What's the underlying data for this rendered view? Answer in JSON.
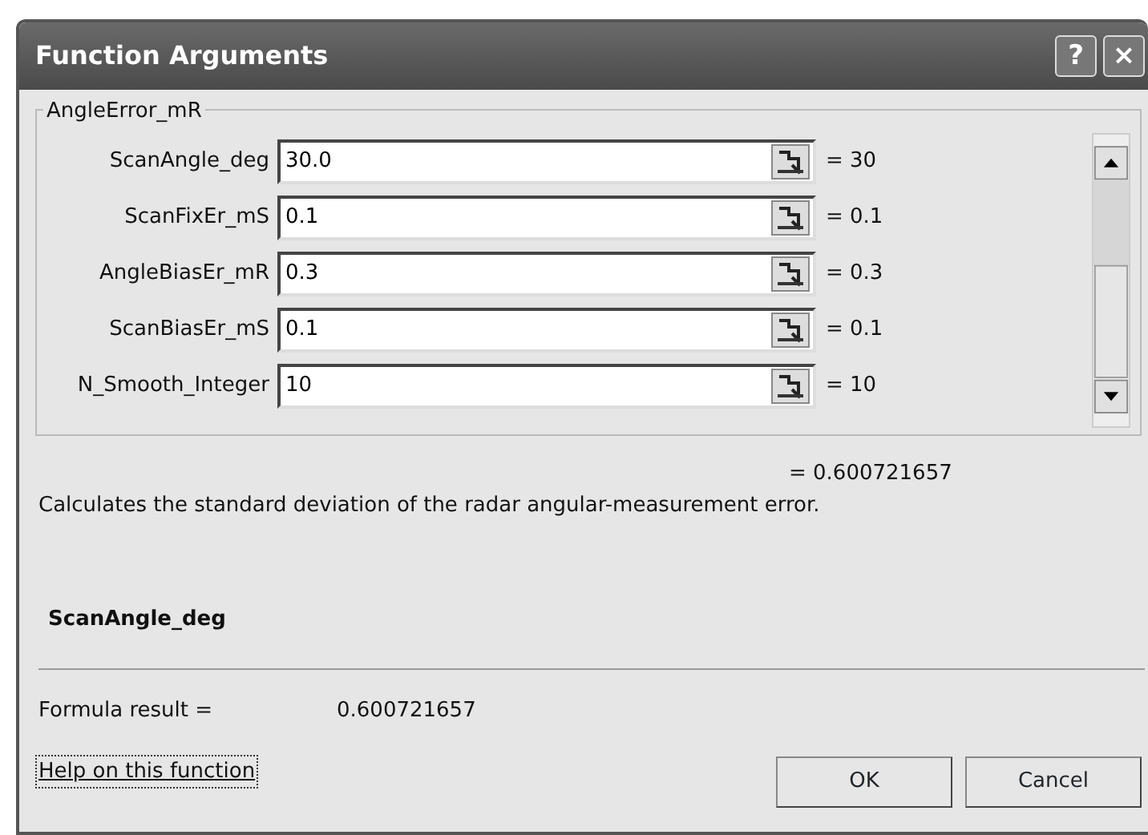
{
  "window": {
    "title": "Function Arguments",
    "controls": [
      "?",
      "×"
    ]
  },
  "group": {
    "legend": "AngleError_mR",
    "arguments": [
      {
        "label": "ScanAngle_deg",
        "value": "30.0",
        "result": "= 30"
      },
      {
        "label": "ScanFixEr_mS",
        "value": "0.1",
        "result": "= 0.1"
      },
      {
        "label": "AngleBiasEr_mR",
        "value": "0.3",
        "result": "= 0.3"
      },
      {
        "label": "ScanBiasEr_mS",
        "value": "0.1",
        "result": "= 0.1"
      },
      {
        "label": "N_Smooth_Integer",
        "value": "10",
        "result": "= 10"
      }
    ]
  },
  "function_result": "= 0.600721657",
  "description": "Calculates the standard deviation of the radar angular-measurement error.",
  "current_argument": "ScanAngle_deg",
  "formula_result": {
    "label": "Formula result =",
    "value": "0.600721657"
  },
  "help_link": {
    "text": "Help on this function",
    "focused": true
  },
  "buttons": [
    "OK",
    "Cancel"
  ]
}
